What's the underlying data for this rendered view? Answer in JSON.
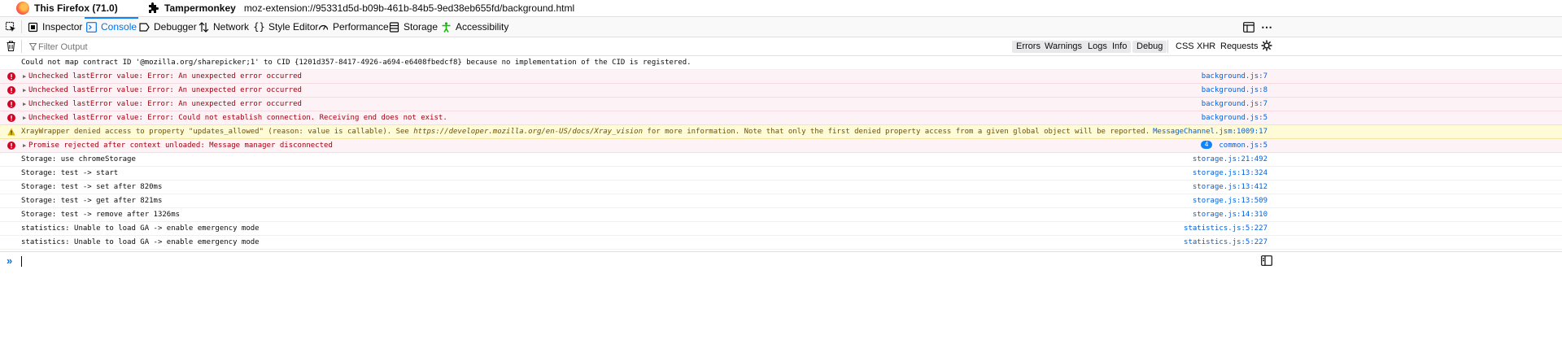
{
  "window": {
    "browser_title": "This Firefox (71.0)",
    "extension_name": "Tampermonkey",
    "extension_url": "moz-extension://95331d5d-b09b-461b-84b5-9ed38eb655fd/background.html"
  },
  "tabs": [
    {
      "label": "Inspector",
      "icon": "inspector-icon"
    },
    {
      "label": "Console",
      "icon": "console-icon",
      "selected": true
    },
    {
      "label": "Debugger",
      "icon": "debugger-icon"
    },
    {
      "label": "Network",
      "icon": "network-icon"
    },
    {
      "label": "Style Editor",
      "icon": "style-editor-icon"
    },
    {
      "label": "Performance",
      "icon": "performance-icon"
    },
    {
      "label": "Storage",
      "icon": "storage-icon"
    },
    {
      "label": "Accessibility",
      "icon": "accessibility-icon"
    }
  ],
  "filter": {
    "placeholder": "Filter Output",
    "levels": [
      "Errors",
      "Warnings",
      "Logs",
      "Info",
      "Debug"
    ],
    "categories": [
      "CSS",
      "XHR",
      "Requests"
    ]
  },
  "messages": [
    {
      "level": "log",
      "text": "Could not map contract ID '@mozilla.org/sharepicker;1' to CID {1201d357-8417-4926-a694-e6408fbedcf8} because no implementation of the CID is registered.",
      "location": ""
    },
    {
      "level": "error",
      "text": "Unchecked lastError value: Error: An unexpected error occurred",
      "location": "background.js:7"
    },
    {
      "level": "error",
      "text": "Unchecked lastError value: Error: An unexpected error occurred",
      "location": "background.js:8"
    },
    {
      "level": "error",
      "text": "Unchecked lastError value: Error: An unexpected error occurred",
      "location": "background.js:7"
    },
    {
      "level": "error",
      "text": "Unchecked lastError value: Error: Could not establish connection. Receiving end does not exist.",
      "location": "background.js:5"
    },
    {
      "level": "warn",
      "text": "XrayWrapper denied access to property \"updates_allowed\" (reason: value is callable). See ",
      "link": "https://developer.mozilla.org/en-US/docs/Xray_vision",
      "text_after": " for more information. Note that only the first denied property access from a given global object will be reported.",
      "location": "MessageChannel.jsm:1009:17"
    },
    {
      "level": "error",
      "text": "Promise rejected after context unloaded: Message manager disconnected",
      "location": "common.js:5",
      "repeat": "4"
    },
    {
      "level": "log",
      "text": "Storage: use chromeStorage",
      "location": "storage.js:21:492"
    },
    {
      "level": "log",
      "text": "Storage: test -> start",
      "location": "storage.js:13:324"
    },
    {
      "level": "log",
      "text": "Storage: test -> set after 820ms",
      "location": "storage.js:13:412"
    },
    {
      "level": "log",
      "text": "Storage: test -> get after 821ms",
      "location": "storage.js:13:509"
    },
    {
      "level": "log",
      "text": "Storage: test -> remove after 1326ms",
      "location": "storage.js:14:310"
    },
    {
      "level": "log",
      "text": "statistics: Unable to load GA -> enable emergency mode",
      "location": "statistics.js:5:227"
    },
    {
      "level": "log",
      "text": "statistics: Unable to load GA -> enable emergency mode",
      "location": "statistics.js:5:227"
    }
  ],
  "input": {
    "prompt": "»",
    "value": ""
  }
}
